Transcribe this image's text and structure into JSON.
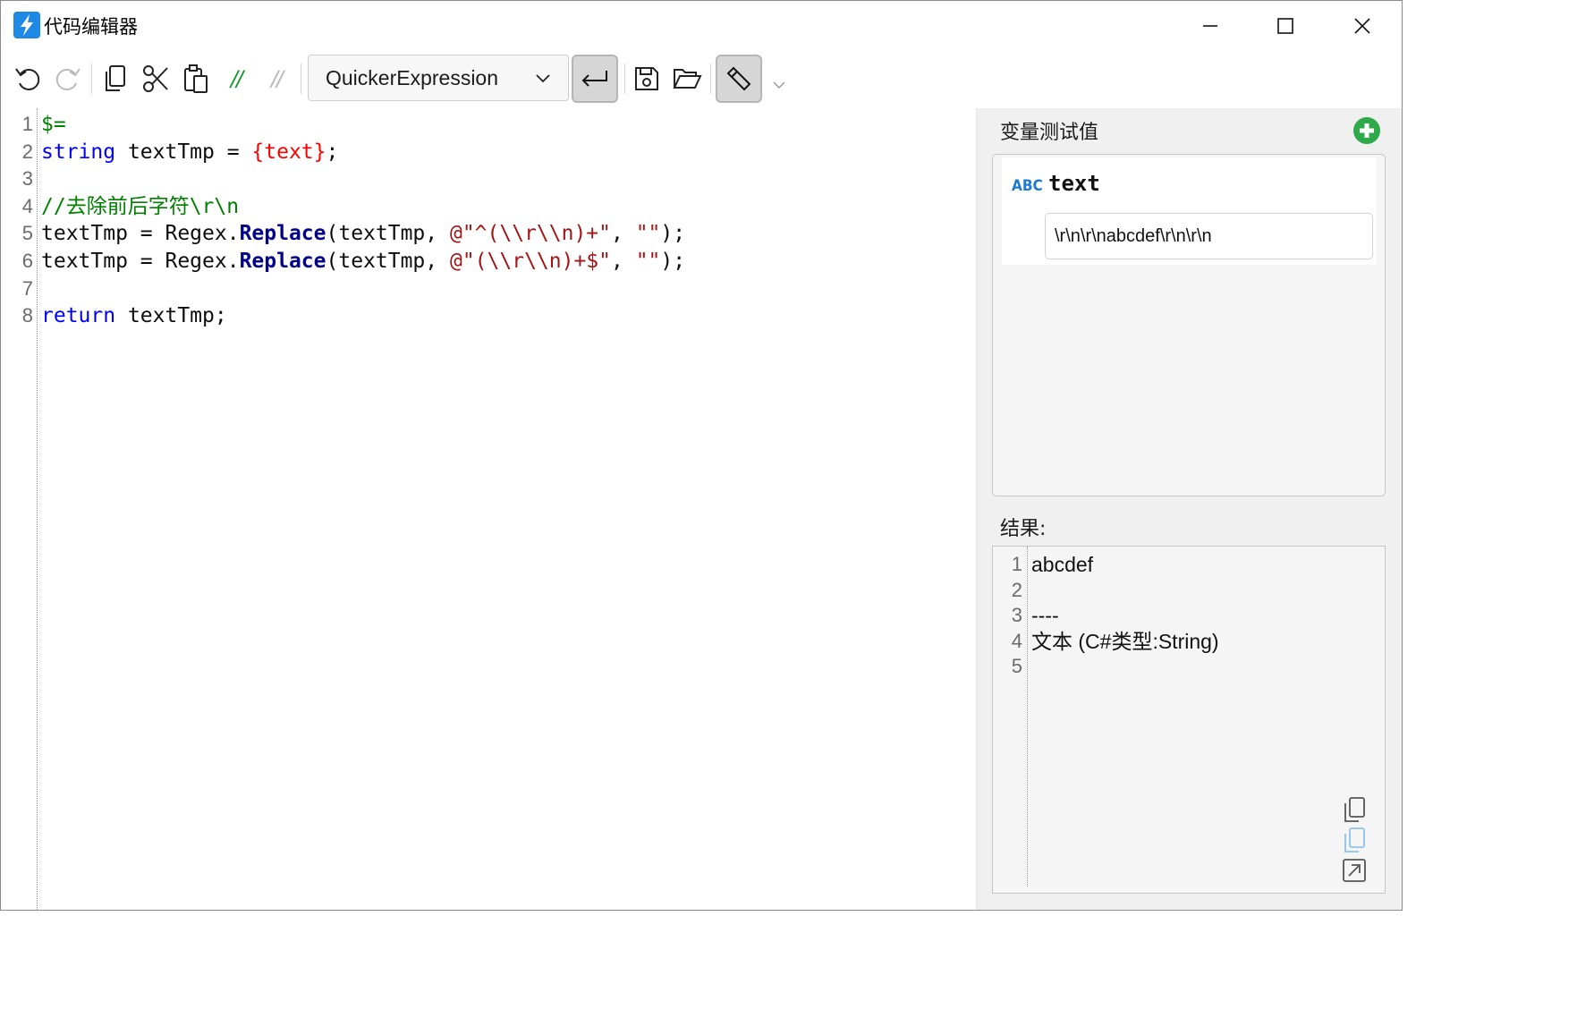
{
  "window": {
    "title": "代码编辑器"
  },
  "toolbar": {
    "comment_label": "//",
    "uncomment_label": "//",
    "language": {
      "selected": "QuickerExpression"
    }
  },
  "editor": {
    "lines": [
      {
        "num": "1",
        "tokens": [
          {
            "t": "$=",
            "c": "k-green"
          }
        ]
      },
      {
        "num": "2",
        "tokens": [
          {
            "t": "string",
            "c": "k-blue"
          },
          {
            "t": " textTmp = ",
            "c": "k-dark"
          },
          {
            "t": "{text}",
            "c": "k-red"
          },
          {
            "t": ";",
            "c": "k-dark"
          }
        ]
      },
      {
        "num": "3",
        "tokens": []
      },
      {
        "num": "4",
        "tokens": [
          {
            "t": "//去除前后字符\\r\\n",
            "c": "k-green"
          }
        ]
      },
      {
        "num": "5",
        "tokens": [
          {
            "t": "textTmp = Regex.",
            "c": "k-dark"
          },
          {
            "t": "Replace",
            "c": "k-method"
          },
          {
            "t": "(textTmp, ",
            "c": "k-dark"
          },
          {
            "t": "@\"^(\\\\r\\\\n)+\"",
            "c": "k-str"
          },
          {
            "t": ", ",
            "c": "k-dark"
          },
          {
            "t": "\"\"",
            "c": "k-str"
          },
          {
            "t": ");",
            "c": "k-dark"
          }
        ]
      },
      {
        "num": "6",
        "tokens": [
          {
            "t": "textTmp = Regex.",
            "c": "k-dark"
          },
          {
            "t": "Replace",
            "c": "k-method"
          },
          {
            "t": "(textTmp, ",
            "c": "k-dark"
          },
          {
            "t": "@\"(\\\\r\\\\n)+$\"",
            "c": "k-str"
          },
          {
            "t": ", ",
            "c": "k-dark"
          },
          {
            "t": "\"\"",
            "c": "k-str"
          },
          {
            "t": ");",
            "c": "k-dark"
          }
        ]
      },
      {
        "num": "7",
        "tokens": []
      },
      {
        "num": "8",
        "tokens": [
          {
            "t": "return",
            "c": "k-blue"
          },
          {
            "t": " textTmp;",
            "c": "k-dark"
          }
        ]
      }
    ]
  },
  "variables": {
    "title": "变量测试值",
    "items": [
      {
        "type_tag": "ABC",
        "name": "text",
        "value": "\\r\\n\\r\\nabcdef\\r\\n\\r\\n"
      }
    ]
  },
  "result": {
    "title": "结果:",
    "lines": [
      {
        "num": "1",
        "text": "abcdef"
      },
      {
        "num": "2",
        "text": ""
      },
      {
        "num": "3",
        "text": "----"
      },
      {
        "num": "4",
        "text": "文本 (C#类型:String)"
      },
      {
        "num": "5",
        "text": ""
      }
    ]
  },
  "colors": {
    "keyword": "#0000ff",
    "placeholder": "#ff0000",
    "comment": "#008000",
    "string": "#a31515",
    "method": "#00008b",
    "accent_green": "#2faa4a",
    "type_tag_blue": "#1f79d1"
  }
}
